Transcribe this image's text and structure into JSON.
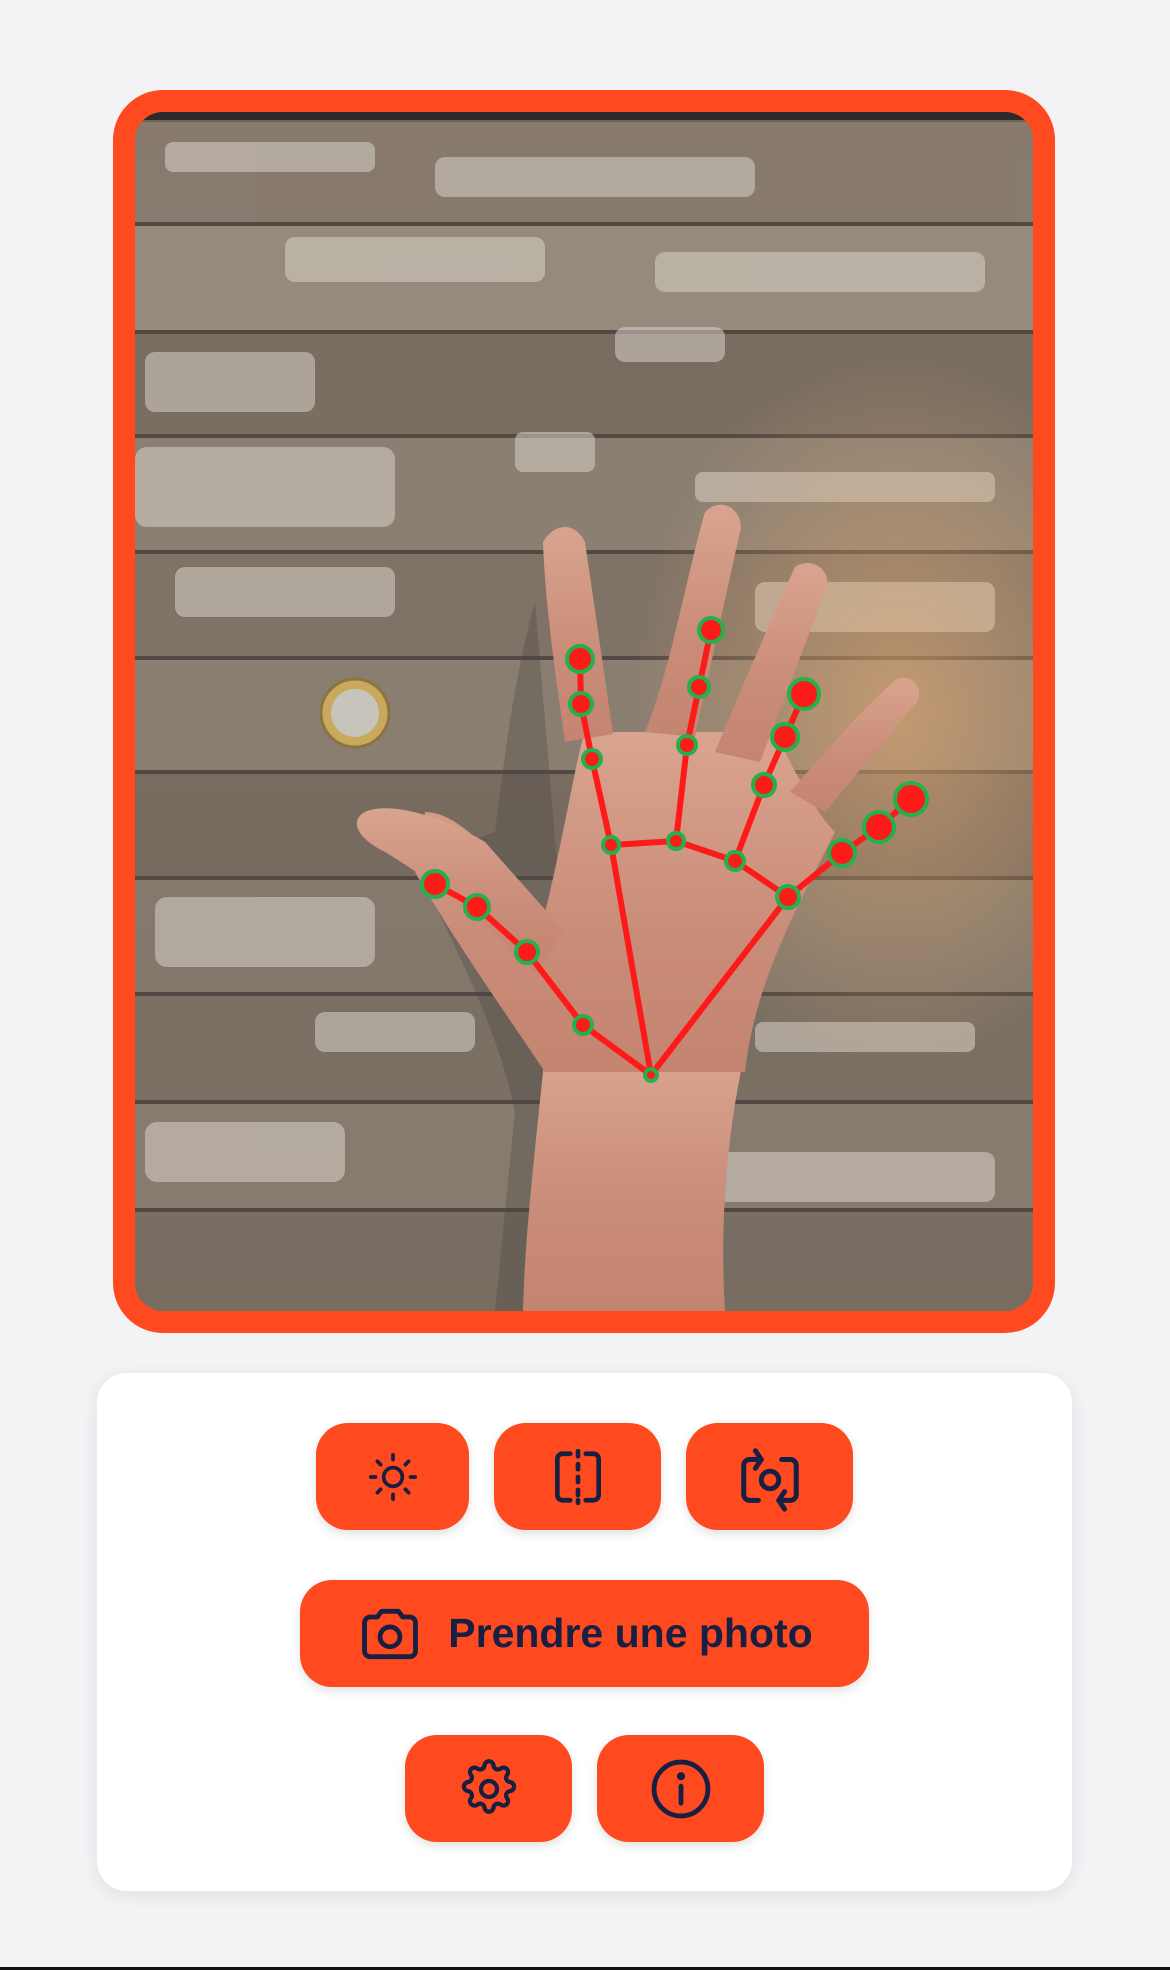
{
  "colors": {
    "accent": "#ff4a1f",
    "icon": "#172042",
    "background": "#f3f2f5",
    "card": "#ffffff",
    "landmark_line": "#ff1a1a",
    "landmark_outline": "#22b14c"
  },
  "camera": {
    "content": "live camera preview of an open hand on a wooden surface with a coin, hand landmark overlay"
  },
  "toolbar": {
    "brightness_icon": "sun-icon",
    "mirror_icon": "flip-horizontal-icon",
    "switch_camera_icon": "camera-rotate-icon",
    "capture_icon": "camera-icon",
    "capture_label": "Prendre une photo",
    "settings_icon": "gear-icon",
    "info_icon": "info-icon"
  }
}
